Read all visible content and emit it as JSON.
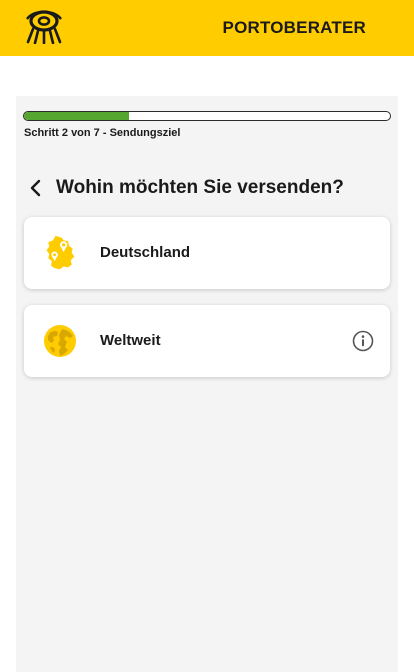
{
  "header": {
    "title": "PORTOBERATER",
    "logo_icon": "posthorn-icon",
    "background_color": "#ffcc00"
  },
  "progress": {
    "current_step": 2,
    "total_steps": 7,
    "fraction": 0.2857,
    "label": "Schritt 2 von 7 - Sendungsziel",
    "fill_color": "#55a630"
  },
  "question": {
    "back_icon": "chevron-left-icon",
    "text": "Wohin möchten Sie versenden?"
  },
  "options": [
    {
      "label": "Deutschland",
      "icon": "germany-map-pin-icon"
    },
    {
      "label": "Weltweit",
      "icon": "globe-icon",
      "info_icon": "info-icon"
    }
  ],
  "colors": {
    "accent": "#ffcc00",
    "icon_yellow": "#ffcc00",
    "icon_dark_yellow": "#d9a800",
    "background_panel": "#f4f4f4"
  }
}
